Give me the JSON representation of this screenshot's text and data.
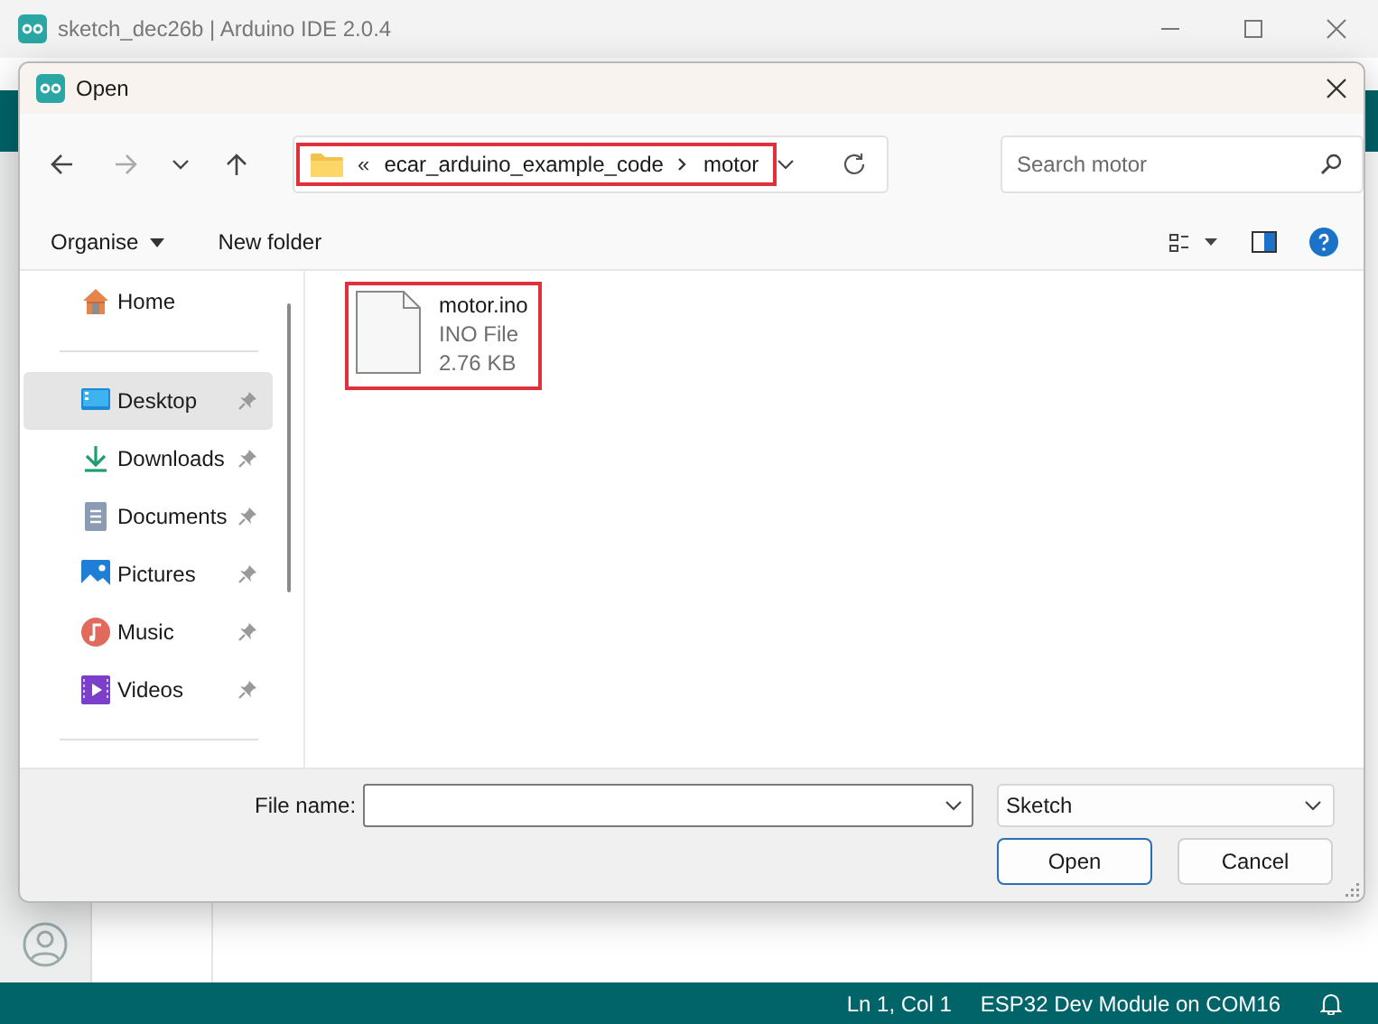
{
  "ide": {
    "title": "sketch_dec26b | Arduino IDE 2.0.4",
    "status_bar": {
      "position": "Ln 1, Col 1",
      "board": "ESP32 Dev Module on COM16"
    }
  },
  "dialog": {
    "title": "Open",
    "address": {
      "overflow": "«",
      "path": [
        "ecar_arduino_example_code",
        "motor"
      ],
      "highlighted": true
    },
    "search": {
      "placeholder": "Search motor"
    },
    "commands": [
      {
        "label": "Organise",
        "dropdown": true
      },
      {
        "label": "New folder",
        "dropdown": false
      }
    ],
    "nav_items": [
      {
        "label": "Home",
        "kind": "home",
        "pinned": false,
        "selected": false
      },
      {
        "label": "Desktop",
        "kind": "desktop",
        "pinned": true,
        "selected": true
      },
      {
        "label": "Downloads",
        "kind": "downloads",
        "pinned": true,
        "selected": false
      },
      {
        "label": "Documents",
        "kind": "documents",
        "pinned": true,
        "selected": false
      },
      {
        "label": "Pictures",
        "kind": "pictures",
        "pinned": true,
        "selected": false
      },
      {
        "label": "Music",
        "kind": "music",
        "pinned": true,
        "selected": false
      },
      {
        "label": "Videos",
        "kind": "videos",
        "pinned": true,
        "selected": false
      }
    ],
    "files": [
      {
        "name": "motor.ino",
        "type": "INO File",
        "size": "2.76 KB",
        "highlighted": true
      }
    ],
    "file_name": {
      "label": "File name:"
    },
    "filter": {
      "value": "Sketch"
    },
    "buttons": [
      {
        "label": "Open",
        "default": true
      },
      {
        "label": "Cancel",
        "default": false
      }
    ]
  }
}
